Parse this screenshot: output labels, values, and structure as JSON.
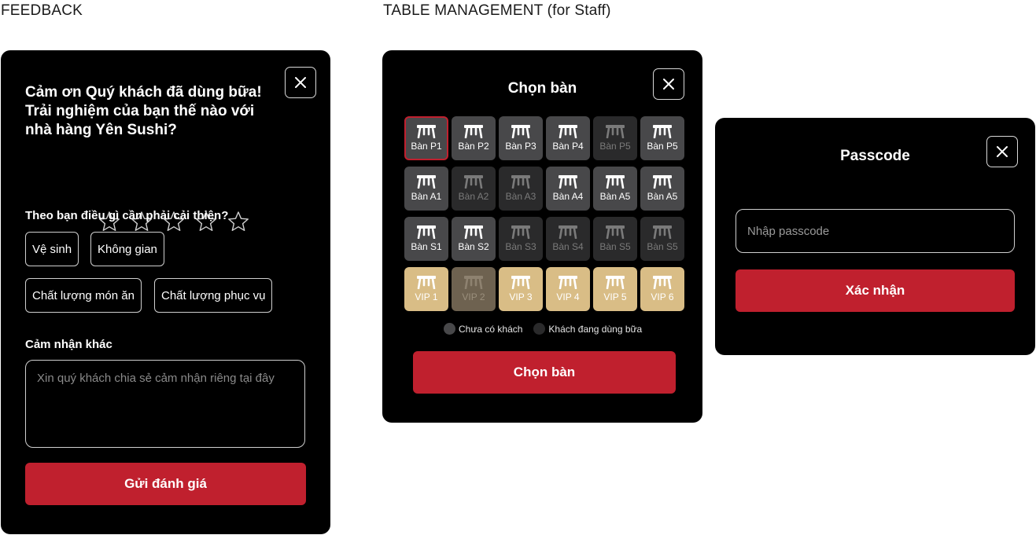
{
  "labels": {
    "feedback": "FEEDBACK",
    "table_management": "TABLE MANAGEMENT (for Staff)"
  },
  "feedback": {
    "title": "Cảm ơn Quý khách đã dùng bữa! Trải nghiệm của bạn thế nào với nhà hàng Yên Sushi?",
    "rating": {
      "value": 0,
      "max": 5
    },
    "improve_question": "Theo bạn điều gì cần phải cải thiện?",
    "options": [
      "Vệ sinh",
      "Không gian",
      "Chất lượng món ăn",
      "Chất lượng phục vụ"
    ],
    "other_label": "Cảm nhận khác",
    "other_placeholder": "Xin quý khách chia sẻ cảm nhận riêng tại đây",
    "submit_label": "Gửi đánh giá"
  },
  "table_management": {
    "title": "Chọn bàn",
    "tables": [
      {
        "name": "Bàn P1",
        "status": "free",
        "selected": true
      },
      {
        "name": "Bàn P2",
        "status": "free"
      },
      {
        "name": "Bàn P3",
        "status": "free"
      },
      {
        "name": "Bàn P4",
        "status": "free"
      },
      {
        "name": "Bàn P5",
        "status": "busy"
      },
      {
        "name": "Bàn P5",
        "status": "free"
      },
      {
        "name": "Bàn A1",
        "status": "free"
      },
      {
        "name": "Bàn A2",
        "status": "busy"
      },
      {
        "name": "Bàn A3",
        "status": "busy"
      },
      {
        "name": "Bàn A4",
        "status": "free"
      },
      {
        "name": "Bàn A5",
        "status": "free"
      },
      {
        "name": "Bàn A5",
        "status": "free"
      },
      {
        "name": "Bàn S1",
        "status": "free"
      },
      {
        "name": "Bàn S2",
        "status": "free"
      },
      {
        "name": "Bàn S3",
        "status": "busy"
      },
      {
        "name": "Bàn S4",
        "status": "busy"
      },
      {
        "name": "Bàn S5",
        "status": "busy"
      },
      {
        "name": "Bàn S5",
        "status": "busy"
      },
      {
        "name": "VIP 1",
        "status": "vip"
      },
      {
        "name": "VIP 2",
        "status": "vipbusy"
      },
      {
        "name": "VIP 3",
        "status": "vip"
      },
      {
        "name": "VIP 4",
        "status": "vip"
      },
      {
        "name": "VIP 5",
        "status": "vip"
      },
      {
        "name": "VIP 6",
        "status": "vip"
      }
    ],
    "legend": [
      {
        "label": "Chưa có khách",
        "color": "#48484a"
      },
      {
        "label": "Khách đang dùng bữa",
        "color": "#2a2a2b"
      }
    ],
    "submit_label": "Chọn bàn"
  },
  "passcode": {
    "title": "Passcode",
    "placeholder": "Nhập passcode",
    "confirm_label": "Xác nhận"
  },
  "colors": {
    "accent": "#c0202e",
    "panel": "#000000",
    "free_table": "#48484a",
    "busy_table": "#2a2a2b",
    "vip_table": "#d9bd86"
  }
}
